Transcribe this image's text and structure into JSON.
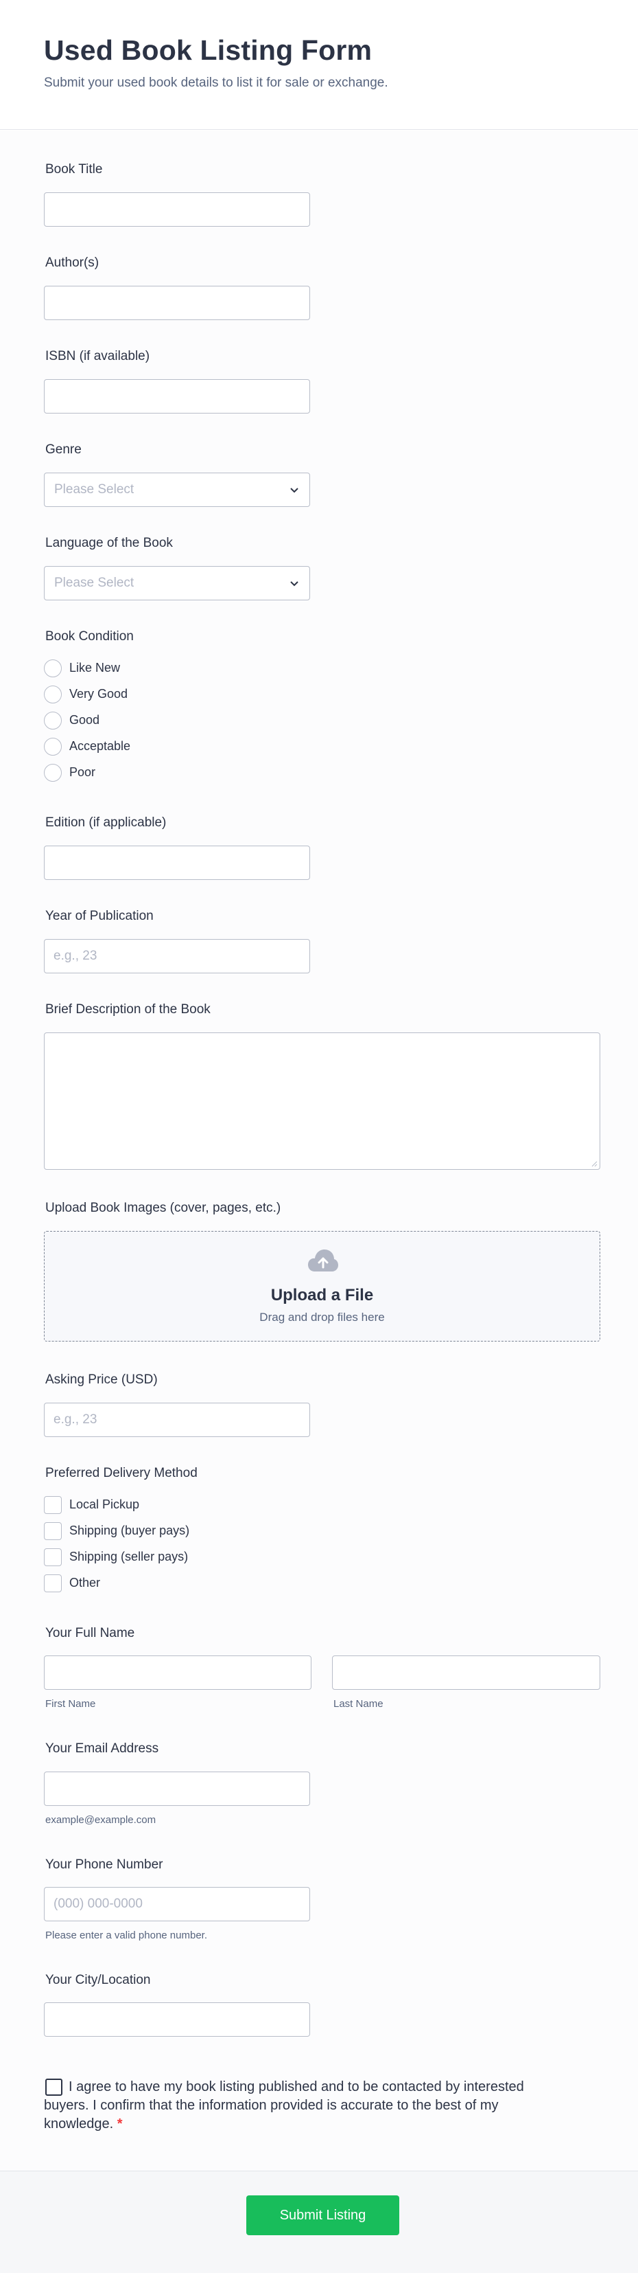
{
  "header": {
    "title": "Used Book Listing Form",
    "subtitle": "Submit your used book details to list it for sale or exchange."
  },
  "fields": {
    "book_title": {
      "label": "Book Title",
      "value": ""
    },
    "authors": {
      "label": "Author(s)",
      "value": ""
    },
    "isbn": {
      "label": "ISBN (if available)",
      "value": ""
    },
    "genre": {
      "label": "Genre",
      "placeholder": "Please Select"
    },
    "language": {
      "label": "Language of the Book",
      "placeholder": "Please Select"
    },
    "condition": {
      "label": "Book Condition",
      "options": [
        "Like New",
        "Very Good",
        "Good",
        "Acceptable",
        "Poor"
      ]
    },
    "edition": {
      "label": "Edition (if applicable)",
      "value": ""
    },
    "year": {
      "label": "Year of Publication",
      "placeholder": "e.g., 23"
    },
    "description": {
      "label": "Brief Description of the Book",
      "value": ""
    },
    "images": {
      "label": "Upload Book Images (cover, pages, etc.)",
      "title": "Upload a File",
      "subtitle": "Drag and drop files here"
    },
    "price": {
      "label": "Asking Price (USD)",
      "placeholder": "e.g., 23"
    },
    "delivery": {
      "label": "Preferred Delivery Method",
      "options": [
        "Local Pickup",
        "Shipping (buyer pays)",
        "Shipping (seller pays)",
        "Other"
      ]
    },
    "full_name": {
      "label": "Your Full Name",
      "first_sublabel": "First Name",
      "last_sublabel": "Last Name"
    },
    "email": {
      "label": "Your Email Address",
      "sublabel": "example@example.com"
    },
    "phone": {
      "label": "Your Phone Number",
      "placeholder": "(000) 000-0000",
      "sublabel": "Please enter a valid phone number."
    },
    "city": {
      "label": "Your City/Location",
      "value": ""
    },
    "agreement": {
      "text": "I agree to have my book listing published and to be contacted by interested buyers. I confirm that the information provided is accurate to the best of my knowledge.",
      "required_mark": "*"
    }
  },
  "footer": {
    "submit_label": "Submit Listing"
  },
  "colors": {
    "submit": "#18bd5b",
    "required": "#f23a3c",
    "text": "#2c3345",
    "muted": "#57647e"
  }
}
